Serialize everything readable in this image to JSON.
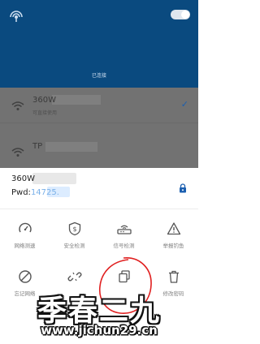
{
  "header": {
    "status": "已连接",
    "wifi_enabled": true
  },
  "networks": [
    {
      "name": "360W",
      "subtitle": "可直接使用",
      "connected": true
    },
    {
      "name": "TP",
      "subtitle": ""
    }
  ],
  "sheet": {
    "name": "360W",
    "pwd_label": "Pwd:",
    "pwd_value": "14725",
    "pwd_suffix": "."
  },
  "actions": [
    {
      "label": "网络测速",
      "icon": "speed-gauge-icon"
    },
    {
      "label": "安全检测",
      "icon": "shield-dollar-icon"
    },
    {
      "label": "信号检测",
      "icon": "router-icon"
    },
    {
      "label": "举报钓鱼",
      "icon": "warning-icon"
    },
    {
      "label": "忘记网络",
      "icon": "forbidden-icon"
    },
    {
      "label": "",
      "icon": "broken-link-icon"
    },
    {
      "label": "",
      "icon": "copy-icon"
    },
    {
      "label": "修改密码",
      "icon": "trash-icon"
    }
  ],
  "watermark": {
    "line1": "季春二九",
    "line2": "www.jichun29.cn"
  },
  "colors": {
    "header_bg": "#0a4a7f",
    "overlay_bg": "#727272",
    "accent": "#1b5fb0",
    "annotation": "#e02020"
  }
}
